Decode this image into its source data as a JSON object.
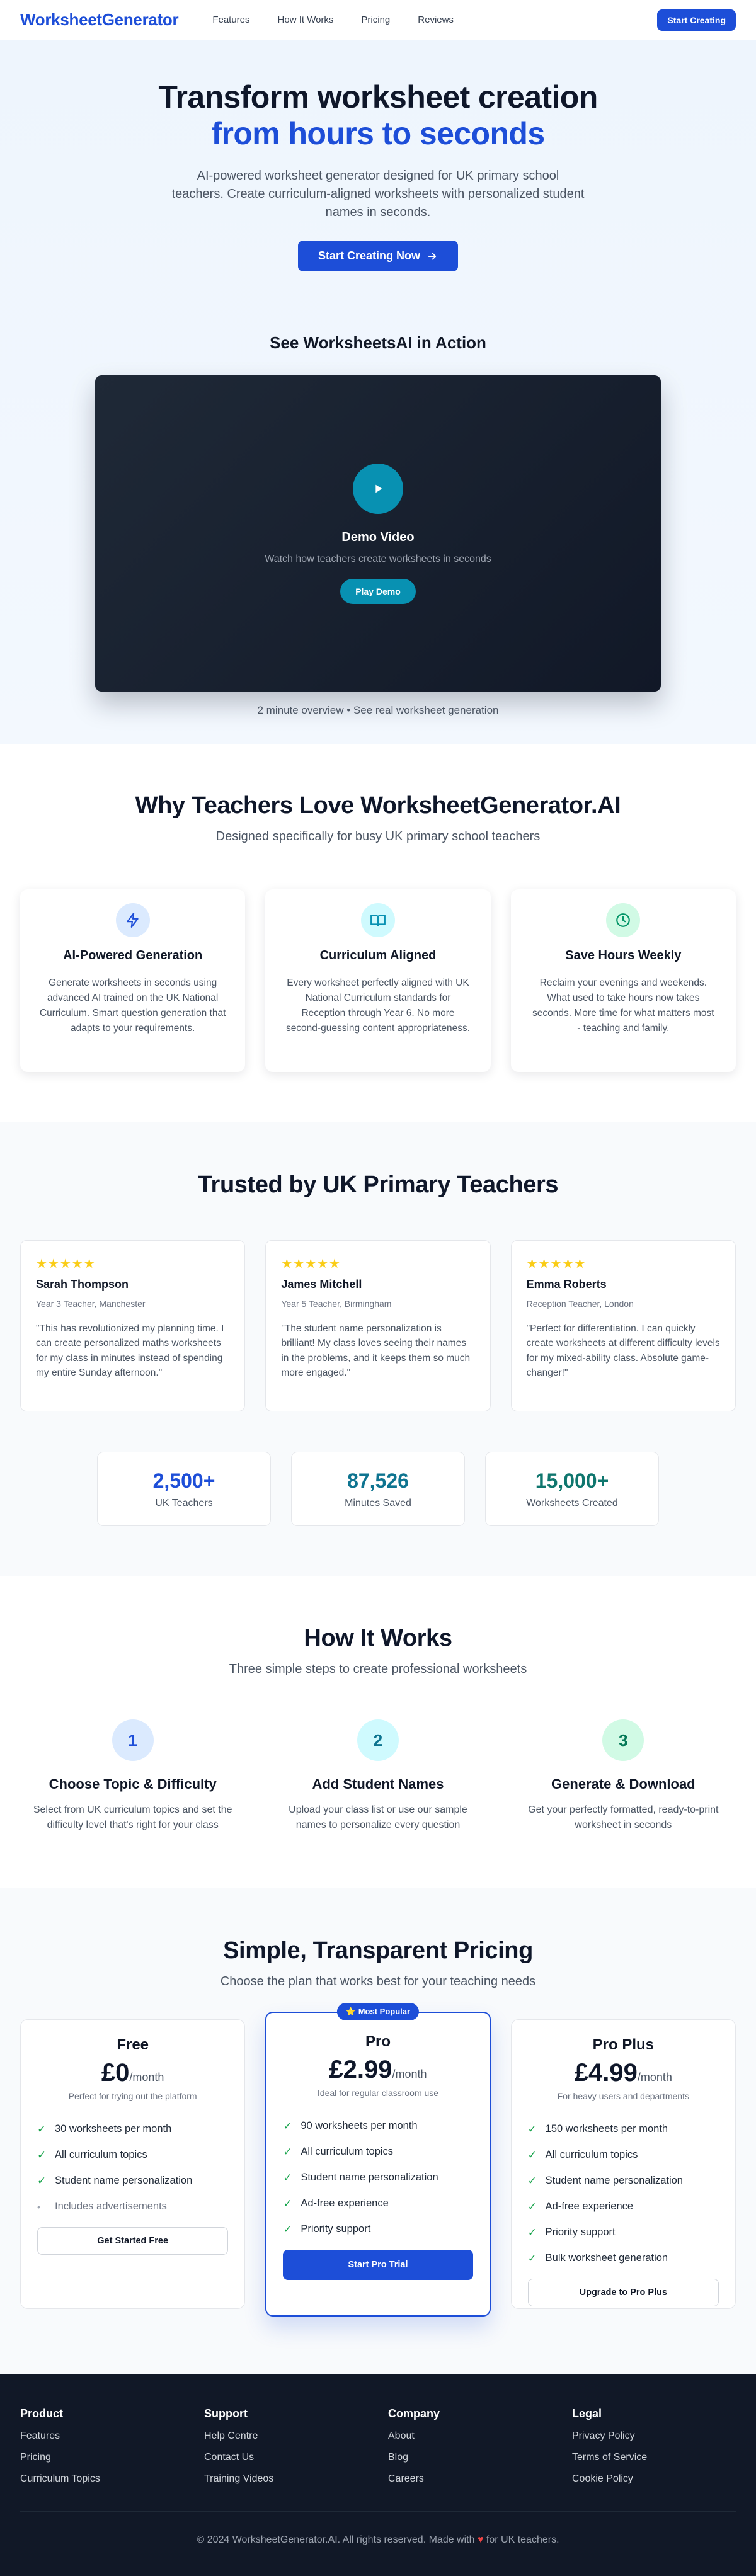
{
  "nav": {
    "brand": "WorksheetGenerator",
    "links": [
      "Features",
      "How It Works",
      "Pricing",
      "Reviews"
    ],
    "cta": "Start Creating"
  },
  "hero": {
    "title_line1": "Transform worksheet creation",
    "title_line2": "from hours to seconds",
    "subtitle": "AI-powered worksheet generator designed for UK primary school teachers. Create curriculum-aligned worksheets with personalized student names in seconds.",
    "button": "Start Creating Now",
    "button_icon": "arrow-right-icon"
  },
  "demo": {
    "heading": "See WorksheetsAI in Action",
    "video_title": "Demo Video",
    "video_subtitle": "Watch how teachers create worksheets in seconds",
    "play_button": "Play Demo",
    "caption": "2 minute overview • See real worksheet generation"
  },
  "features": {
    "title": "Why Teachers Love WorksheetGenerator.AI",
    "subtitle": "Designed specifically for busy UK primary school teachers",
    "items": [
      {
        "icon": "lightning-icon",
        "title": "AI-Powered Generation",
        "desc": "Generate worksheets in seconds using advanced AI trained on the UK National Curriculum. Smart question generation that adapts to your requirements."
      },
      {
        "icon": "book-open-icon",
        "title": "Curriculum Aligned",
        "desc": "Every worksheet perfectly aligned with UK National Curriculum standards for Reception through Year 6. No more second-guessing content appropriateness."
      },
      {
        "icon": "clock-icon",
        "title": "Save Hours Weekly",
        "desc": "Reclaim your evenings and weekends. What used to take hours now takes seconds. More time for what matters most - teaching and family."
      }
    ]
  },
  "testimonials": {
    "title": "Trusted by UK Primary Teachers",
    "stars": "★★★★★",
    "items": [
      {
        "name": "Sarah Thompson",
        "role": "Year 3 Teacher, Manchester",
        "quote": "\"This has revolutionized my planning time. I can create personalized maths worksheets for my class in minutes instead of spending my entire Sunday afternoon.\""
      },
      {
        "name": "James Mitchell",
        "role": "Year 5 Teacher, Birmingham",
        "quote": "\"The student name personalization is brilliant! My class loves seeing their names in the problems, and it keeps them so much more engaged.\""
      },
      {
        "name": "Emma Roberts",
        "role": "Reception Teacher, London",
        "quote": "\"Perfect for differentiation. I can quickly create worksheets at different difficulty levels for my mixed-ability class. Absolute game-changer!\""
      }
    ],
    "stats": [
      {
        "value": "2,500+",
        "label": "UK Teachers",
        "color": "#1d4ed8"
      },
      {
        "value": "87,526",
        "label": "Minutes Saved",
        "color": "#0e7490"
      },
      {
        "value": "15,000+",
        "label": "Worksheets Created",
        "color": "#0f766e"
      }
    ]
  },
  "how": {
    "title": "How It Works",
    "subtitle": "Three simple steps to create professional worksheets",
    "steps": [
      {
        "num": "1",
        "title": "Choose Topic & Difficulty",
        "desc": "Select from UK curriculum topics and set the difficulty level that's right for your class"
      },
      {
        "num": "2",
        "title": "Add Student Names",
        "desc": "Upload your class list or use our sample names to personalize every question"
      },
      {
        "num": "3",
        "title": "Generate & Download",
        "desc": "Get your perfectly formatted, ready-to-print worksheet in seconds"
      }
    ]
  },
  "pricing": {
    "title": "Simple, Transparent Pricing",
    "subtitle": "Choose the plan that works best for your teaching needs",
    "badge": "⭐ Most Popular",
    "plans": [
      {
        "name": "Free",
        "price": "£0",
        "period": "/month",
        "desc": "Perfect for trying out the platform",
        "features": [
          "30 worksheets per month",
          "All curriculum topics",
          "Student name personalization"
        ],
        "muted": "Includes advertisements",
        "button": "Get Started Free"
      },
      {
        "name": "Pro",
        "price": "£2.99",
        "period": "/month",
        "desc": "Ideal for regular classroom use",
        "features": [
          "90 worksheets per month",
          "All curriculum topics",
          "Student name personalization",
          "Ad-free experience",
          "Priority support"
        ],
        "button": "Start Pro Trial"
      },
      {
        "name": "Pro Plus",
        "price": "£4.99",
        "period": "/month",
        "desc": "For heavy users and departments",
        "features": [
          "150 worksheets per month",
          "All curriculum topics",
          "Student name personalization",
          "Ad-free experience",
          "Priority support",
          "Bulk worksheet generation"
        ],
        "button": "Upgrade to Pro Plus"
      }
    ]
  },
  "footer": {
    "columns": [
      {
        "heading": "Product",
        "links": [
          "Features",
          "Pricing",
          "Curriculum Topics"
        ]
      },
      {
        "heading": "Support",
        "links": [
          "Help Centre",
          "Contact Us",
          "Training Videos"
        ]
      },
      {
        "heading": "Company",
        "links": [
          "About",
          "Blog",
          "Careers"
        ]
      },
      {
        "heading": "Legal",
        "links": [
          "Privacy Policy",
          "Terms of Service",
          "Cookie Policy"
        ]
      }
    ],
    "copyright_pre": "© 2024 WorksheetGenerator.AI. All rights reserved. Made with",
    "heart": "♥",
    "copyright_post": "for UK teachers."
  }
}
